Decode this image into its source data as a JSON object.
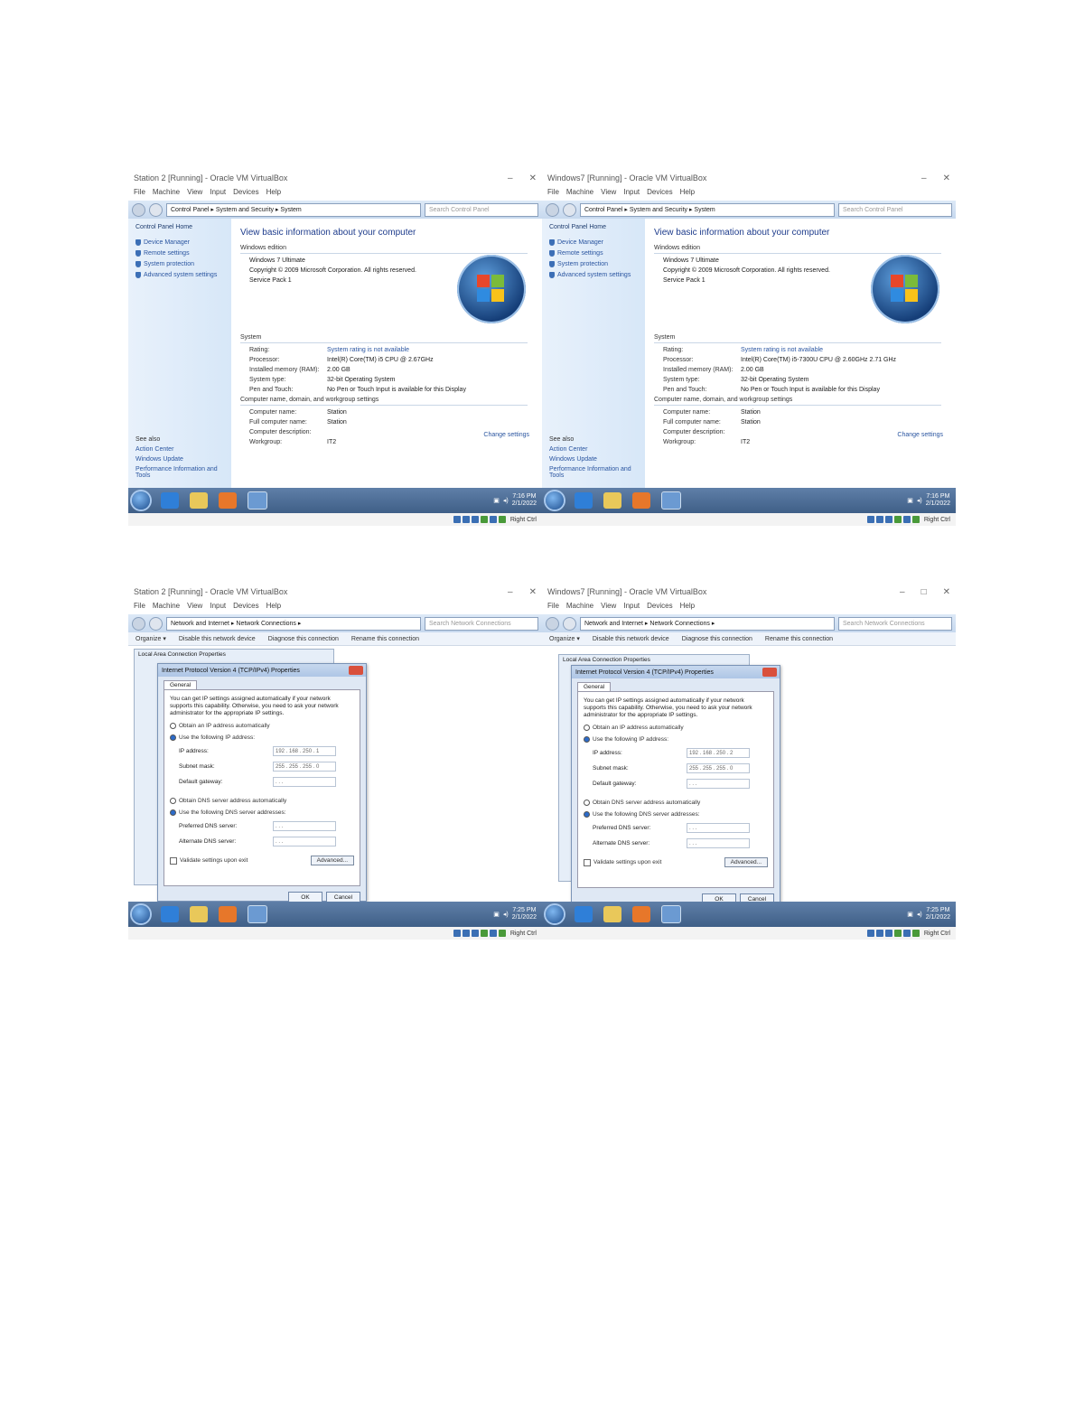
{
  "top_left": {
    "window_title": "Station 2 [Running] - Oracle VM VirtualBox",
    "menu": [
      "File",
      "Machine",
      "View",
      "Input",
      "Devices",
      "Help"
    ],
    "breadcrumb": "Control Panel ▸ System and Security ▸ System",
    "search_placeholder": "Search Control Panel",
    "sidebar": {
      "home": "Control Panel Home",
      "links": [
        "Device Manager",
        "Remote settings",
        "System protection",
        "Advanced system settings"
      ],
      "see_also": "See also",
      "see_links": [
        "Action Center",
        "Windows Update",
        "Performance Information and Tools"
      ]
    },
    "heading": "View basic information about your computer",
    "edition_section": "Windows edition",
    "edition": "Windows 7 Ultimate",
    "copyright": "Copyright © 2009 Microsoft Corporation. All rights reserved.",
    "service_pack": "Service Pack 1",
    "system_section": "System",
    "system_rows": [
      {
        "k": "Rating:",
        "v": "System rating is not available"
      },
      {
        "k": "Processor:",
        "v": "Intel(R) Core(TM) i5 CPU @ 2.67GHz"
      },
      {
        "k": "Installed memory (RAM):",
        "v": "2.00 GB"
      },
      {
        "k": "System type:",
        "v": "32-bit Operating System"
      },
      {
        "k": "Pen and Touch:",
        "v": "No Pen or Touch Input is available for this Display"
      }
    ],
    "cn_section": "Computer name, domain, and workgroup settings",
    "cn_rows": [
      {
        "k": "Computer name:",
        "v": "Station"
      },
      {
        "k": "Full computer name:",
        "v": "Station"
      },
      {
        "k": "Computer description:",
        "v": ""
      },
      {
        "k": "Workgroup:",
        "v": "IT2"
      }
    ],
    "change_settings": "Change settings",
    "clock_time": "7:16 PM",
    "clock_date": "2/1/2022",
    "host_key": "Right Ctrl"
  },
  "top_right": {
    "window_title": "Windows7 [Running] - Oracle VM VirtualBox",
    "menu": [
      "File",
      "Machine",
      "View",
      "Input",
      "Devices",
      "Help"
    ],
    "breadcrumb": "Control Panel ▸ System and Security ▸ System",
    "search_placeholder": "Search Control Panel",
    "sidebar": {
      "home": "Control Panel Home",
      "links": [
        "Device Manager",
        "Remote settings",
        "System protection",
        "Advanced system settings"
      ],
      "see_also": "See also",
      "see_links": [
        "Action Center",
        "Windows Update",
        "Performance Information and Tools"
      ]
    },
    "heading": "View basic information about your computer",
    "edition_section": "Windows edition",
    "edition": "Windows 7 Ultimate",
    "copyright": "Copyright © 2009 Microsoft Corporation. All rights reserved.",
    "service_pack": "Service Pack 1",
    "system_section": "System",
    "system_rows": [
      {
        "k": "Rating:",
        "v": "System rating is not available"
      },
      {
        "k": "Processor:",
        "v": "Intel(R) Core(TM) i5-7300U CPU @ 2.60GHz 2.71 GHz"
      },
      {
        "k": "Installed memory (RAM):",
        "v": "2.00 GB"
      },
      {
        "k": "System type:",
        "v": "32-bit Operating System"
      },
      {
        "k": "Pen and Touch:",
        "v": "No Pen or Touch Input is available for this Display"
      }
    ],
    "cn_section": "Computer name, domain, and workgroup settings",
    "cn_rows": [
      {
        "k": "Computer name:",
        "v": "Station"
      },
      {
        "k": "Full computer name:",
        "v": "Station"
      },
      {
        "k": "Computer description:",
        "v": ""
      },
      {
        "k": "Workgroup:",
        "v": "IT2"
      }
    ],
    "change_settings": "Change settings",
    "clock_time": "7:16 PM",
    "clock_date": "2/1/2022",
    "host_key": "Right Ctrl"
  },
  "bottom_left": {
    "window_title": "Station 2 [Running] - Oracle VM VirtualBox",
    "menu": [
      "File",
      "Machine",
      "View",
      "Input",
      "Devices",
      "Help"
    ],
    "breadcrumb": "Network and Internet ▸ Network Connections ▸",
    "search_placeholder": "Search Network Connections",
    "commands": [
      "Organize ▾",
      "Disable this network device",
      "Diagnose this connection",
      "Rename this connection"
    ],
    "behind_title": "Local Area Connection Properties",
    "dialog_title": "Internet Protocol Version 4 (TCP/IPv4) Properties",
    "tab": "General",
    "intro": "You can get IP settings assigned automatically if your network supports this capability. Otherwise, you need to ask your network administrator for the appropriate IP settings.",
    "auto_ip": "Obtain an IP address automatically",
    "use_ip": "Use the following IP address:",
    "ip_label": "IP address:",
    "ip_value": "192 . 168 . 250 . 1",
    "mask_label": "Subnet mask:",
    "mask_value": "255 . 255 . 255 . 0",
    "gw_label": "Default gateway:",
    "gw_value": ". . .",
    "auto_dns": "Obtain DNS server address automatically",
    "use_dns": "Use the following DNS server addresses:",
    "pdns_label": "Preferred DNS server:",
    "pdns_value": ". . .",
    "adns_label": "Alternate DNS server:",
    "adns_value": ". . .",
    "validate": "Validate settings upon exit",
    "advanced": "Advanced...",
    "ok": "OK",
    "cancel": "Cancel",
    "clock_time": "7:25 PM",
    "clock_date": "2/1/2022",
    "host_key": "Right Ctrl"
  },
  "bottom_right": {
    "window_title": "Windows7 [Running] - Oracle VM VirtualBox",
    "menu": [
      "File",
      "Machine",
      "View",
      "Input",
      "Devices",
      "Help"
    ],
    "breadcrumb": "Network and Internet ▸ Network Connections ▸",
    "search_placeholder": "Search Network Connections",
    "commands": [
      "Organize ▾",
      "Disable this network device",
      "Diagnose this connection",
      "Rename this connection"
    ],
    "behind_title": "Local Area Connection Properties",
    "dialog_title": "Internet Protocol Version 4 (TCP/IPv4) Properties",
    "tab": "General",
    "intro": "You can get IP settings assigned automatically if your network supports this capability. Otherwise, you need to ask your network administrator for the appropriate IP settings.",
    "auto_ip": "Obtain an IP address automatically",
    "use_ip": "Use the following IP address:",
    "ip_label": "IP address:",
    "ip_value": "192 . 168 . 250 . 2",
    "mask_label": "Subnet mask:",
    "mask_value": "255 . 255 . 255 . 0",
    "gw_label": "Default gateway:",
    "gw_value": ". . .",
    "auto_dns": "Obtain DNS server address automatically",
    "use_dns": "Use the following DNS server addresses:",
    "pdns_label": "Preferred DNS server:",
    "pdns_value": ". . .",
    "adns_label": "Alternate DNS server:",
    "adns_value": ". . .",
    "validate": "Validate settings upon exit",
    "advanced": "Advanced...",
    "ok": "OK",
    "cancel": "Cancel",
    "clock_time": "7:25 PM",
    "clock_date": "2/1/2022",
    "host_key": "Right Ctrl"
  }
}
